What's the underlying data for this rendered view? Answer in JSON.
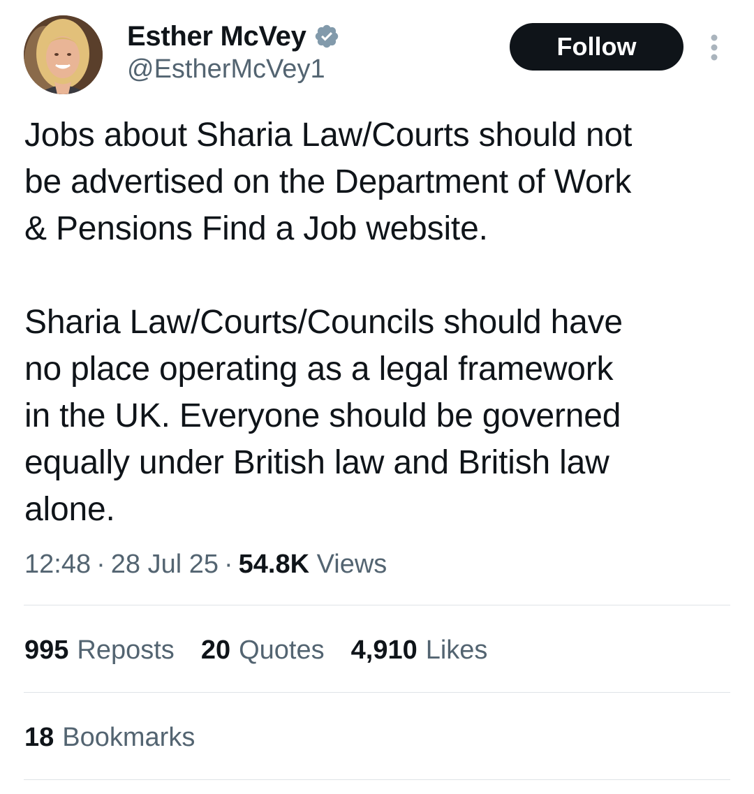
{
  "author": {
    "display_name": "Esther McVey",
    "handle": "@EstherMcVey1",
    "verified_icon": "verified-badge-icon",
    "verified_color": "#829aab"
  },
  "follow_button": {
    "label": "Follow"
  },
  "more_menu": {
    "icon": "more-vertical-icon"
  },
  "tweet": {
    "text": "Jobs about Sharia Law/Courts should not\nbe advertised on the Department of Work\n& Pensions Find a Job website.\n\nSharia Law/Courts/Councils should have\nno place operating as a legal framework\nin the UK. Everyone should be governed\nequally under British law and British law\nalone."
  },
  "meta": {
    "time": "12:48",
    "separator": "·",
    "date": "28 Jul 25",
    "views_count": "54.8K",
    "views_label": "Views"
  },
  "stats": {
    "reposts": {
      "count": "995",
      "label": "Reposts"
    },
    "quotes": {
      "count": "20",
      "label": "Quotes"
    },
    "likes": {
      "count": "4,910",
      "label": "Likes"
    },
    "bookmarks": {
      "count": "18",
      "label": "Bookmarks"
    }
  },
  "colors": {
    "text_primary": "#0f1419",
    "text_secondary": "#536471",
    "follow_bg": "#0f1419",
    "divider": "#dfe3e7"
  }
}
